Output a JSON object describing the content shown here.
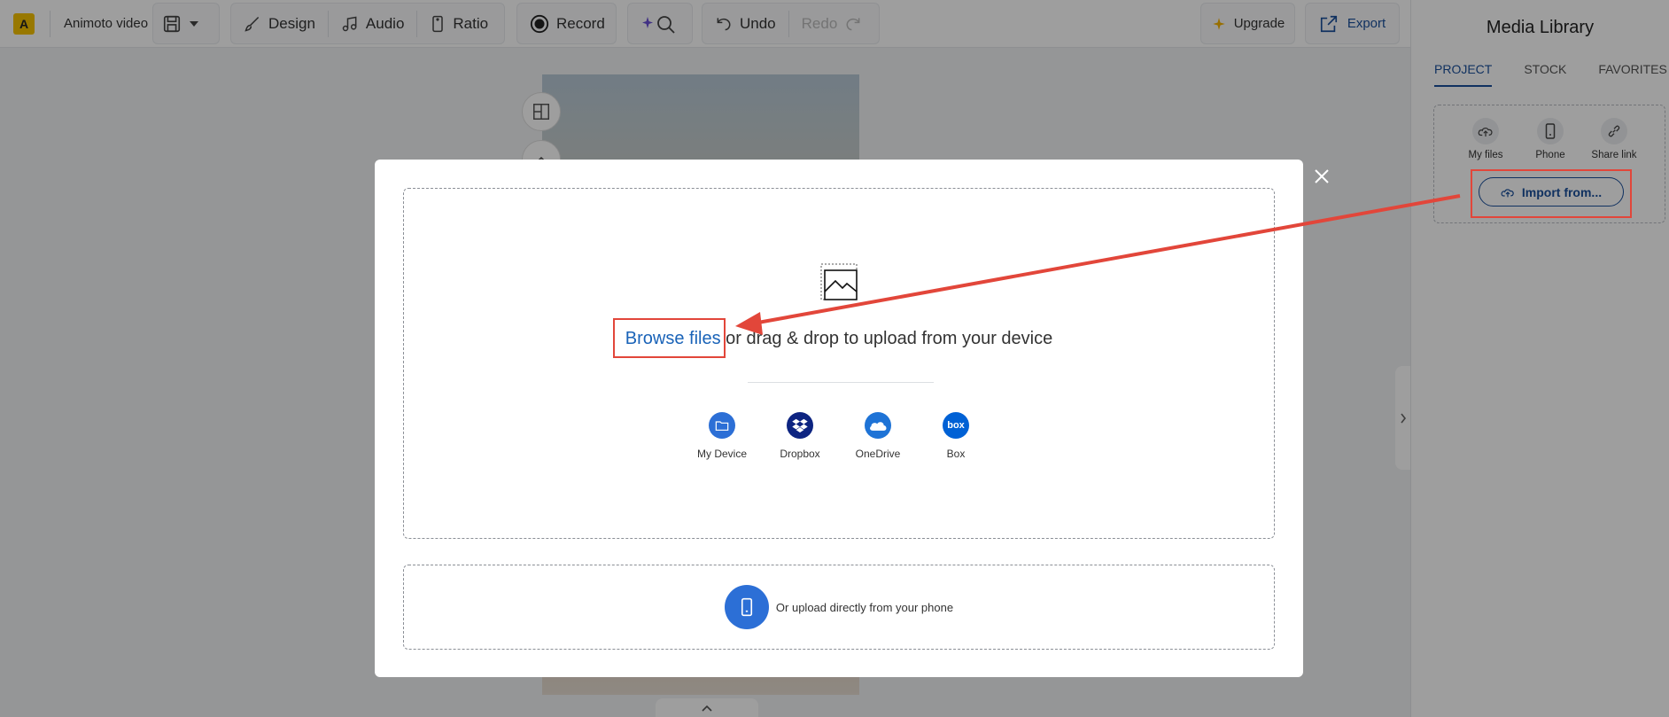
{
  "toolbar": {
    "logo": "A",
    "project_title": "Animoto video",
    "design_label": "Design",
    "audio_label": "Audio",
    "ratio_label": "Ratio",
    "record_label": "Record",
    "undo_label": "Undo",
    "redo_label": "Redo",
    "upgrade_label": "Upgrade",
    "export_label": "Export"
  },
  "media_library": {
    "title": "Media Library",
    "tabs": [
      {
        "label": "PROJECT",
        "active": true
      },
      {
        "label": "STOCK",
        "active": false
      },
      {
        "label": "FAVORITES",
        "active": false
      }
    ],
    "upload_options": [
      {
        "label": "My files",
        "icon": "cloud-upload-icon"
      },
      {
        "label": "Phone",
        "icon": "phone-icon"
      },
      {
        "label": "Share link",
        "icon": "link-icon"
      }
    ],
    "import_label": "Import from..."
  },
  "modal": {
    "browse_link": "Browse files",
    "browse_rest": " or drag & drop to upload from your device",
    "sources": [
      {
        "label": "My Device",
        "color": "#2c6fd6",
        "icon": "folder-icon"
      },
      {
        "label": "Dropbox",
        "color": "#0d2481",
        "icon": "dropbox-icon"
      },
      {
        "label": "OneDrive",
        "color": "#1e73d6",
        "icon": "cloud-icon"
      },
      {
        "label": "Box",
        "color": "#0061d5",
        "icon": "box-icon",
        "glyph": "box"
      }
    ],
    "phone_text": "Or upload directly from your phone"
  },
  "colors": {
    "accent": "#1a4f9c",
    "link": "#1a63b8",
    "annotation": "#e2463a"
  }
}
